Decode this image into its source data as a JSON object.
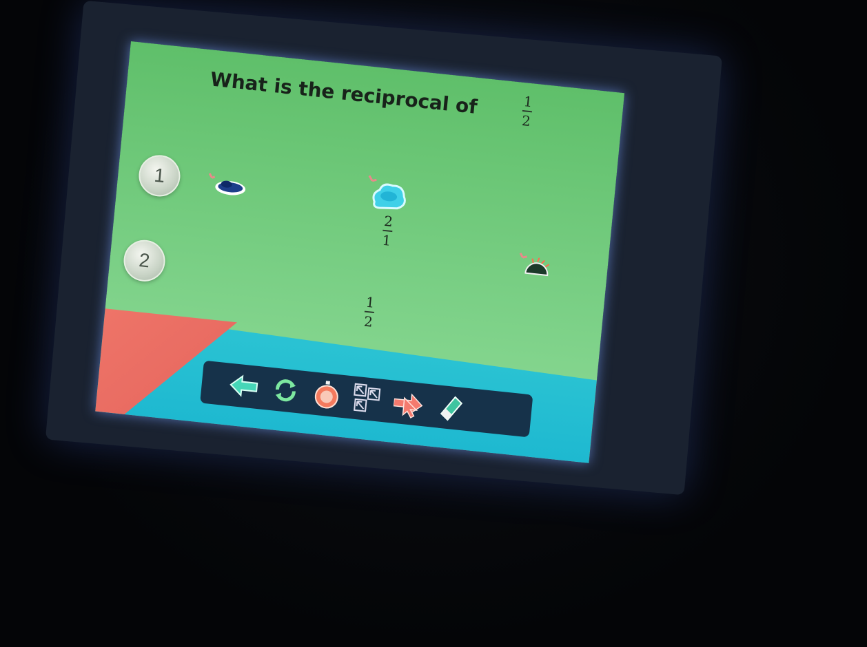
{
  "question": {
    "text": "What is the reciprocal of",
    "fraction": {
      "numerator": "1",
      "denominator": "2"
    }
  },
  "choices": [
    {
      "label": "1",
      "fraction": {
        "numerator": "2",
        "denominator": "1"
      }
    },
    {
      "label": "2",
      "fraction": {
        "numerator": "1",
        "denominator": "2"
      }
    }
  ],
  "stickers": [
    "cloud-icon",
    "cloud-icon",
    "sun-icon"
  ],
  "toolbar": {
    "tools": [
      "back-arrow-icon",
      "refresh-icon",
      "timer-icon",
      "cursor-arrows-icon",
      "pointer-arrow-icon",
      "eraser-icon"
    ]
  },
  "colors": {
    "screen_green": "#6fc97a",
    "accent_cyan": "#1cb7d0",
    "accent_red": "#ee7468",
    "toolbar_bg": "#16324a"
  }
}
